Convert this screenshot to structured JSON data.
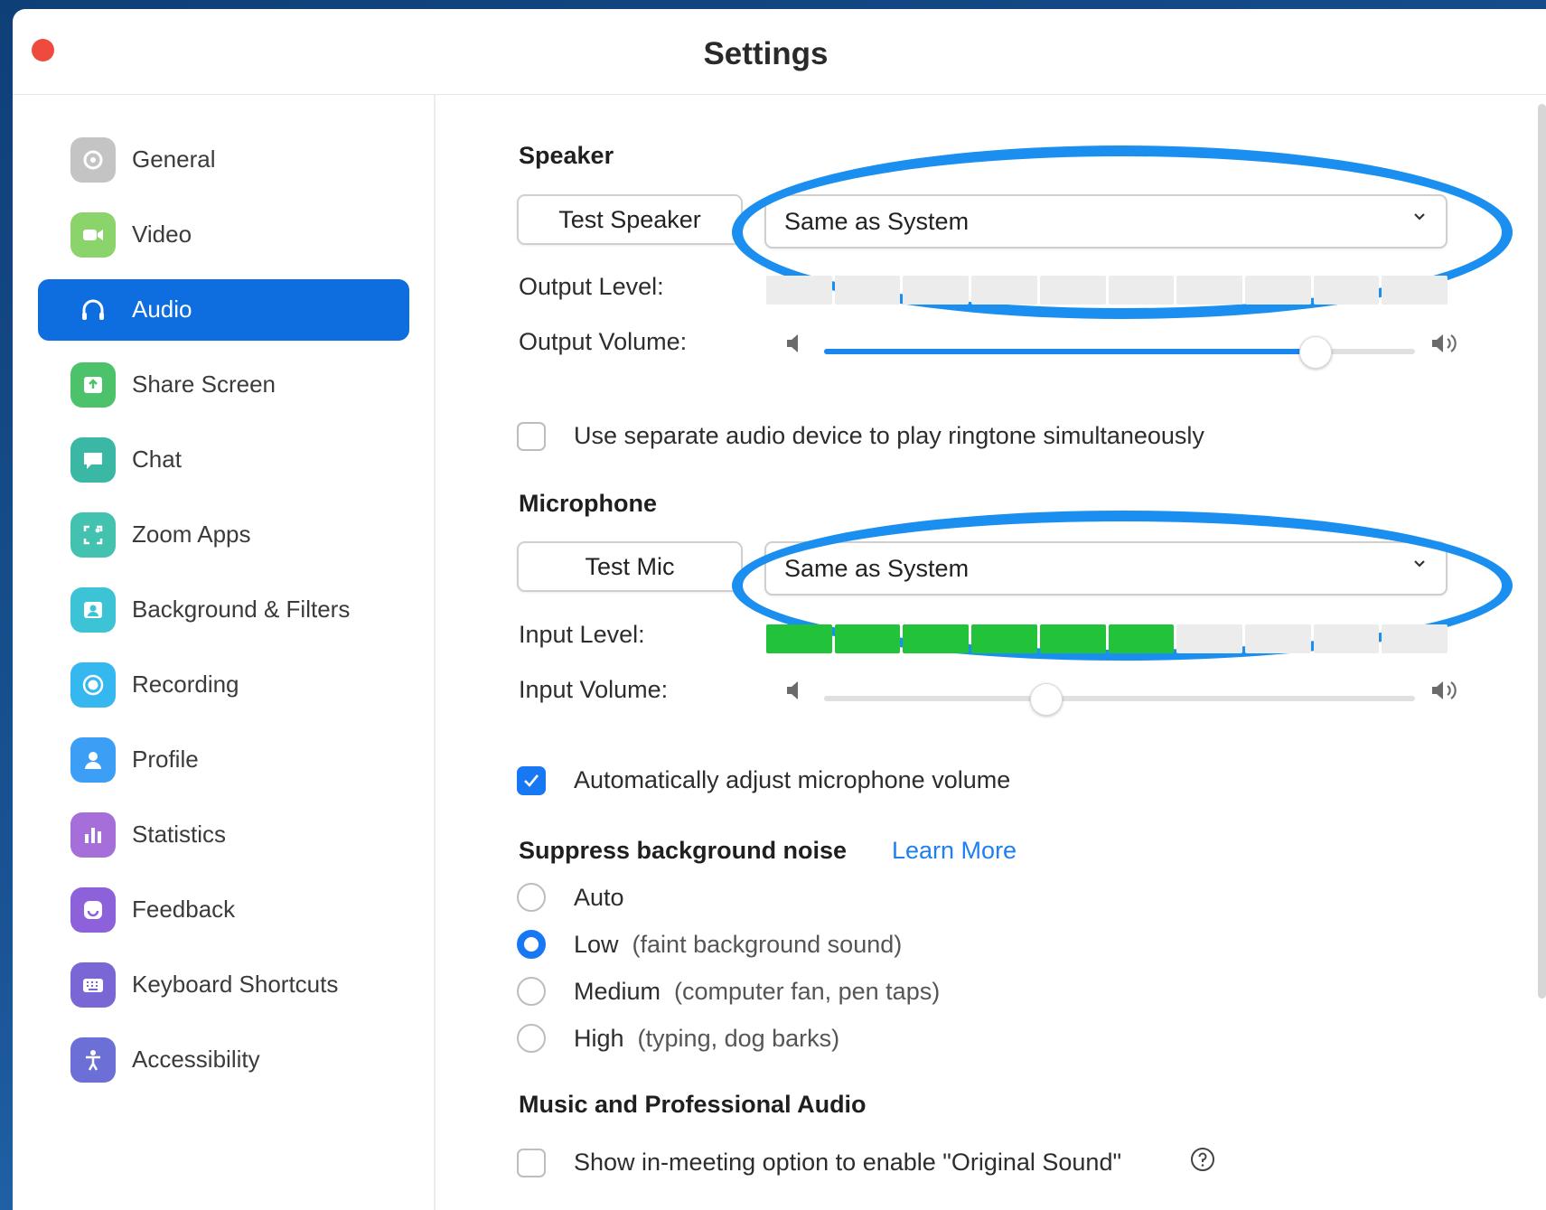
{
  "window": {
    "title": "Settings"
  },
  "sidebar": {
    "items": [
      {
        "label": "General",
        "color": "#b9b9b9"
      },
      {
        "label": "Video",
        "color": "#8bd36b"
      },
      {
        "label": "Audio",
        "color": "#0e6ee0"
      },
      {
        "label": "Share Screen",
        "color": "#4cc26b"
      },
      {
        "label": "Chat",
        "color": "#3bb7a5"
      },
      {
        "label": "Zoom Apps",
        "color": "#43c2b0"
      },
      {
        "label": "Background & Filters",
        "color": "#3cc3d6"
      },
      {
        "label": "Recording",
        "color": "#35b8f0"
      },
      {
        "label": "Profile",
        "color": "#3d9ef5"
      },
      {
        "label": "Statistics",
        "color": "#a56ed8"
      },
      {
        "label": "Feedback",
        "color": "#8d61d9"
      },
      {
        "label": "Keyboard Shortcuts",
        "color": "#7b66d6"
      },
      {
        "label": "Accessibility",
        "color": "#6b6fd6"
      }
    ],
    "active_index": 2
  },
  "speaker": {
    "heading": "Speaker",
    "test_button": "Test Speaker",
    "device": "Same as System",
    "output_level_label": "Output Level:",
    "output_level_segments_on": 0,
    "output_level_segments_total": 10,
    "output_volume_label": "Output Volume:",
    "output_volume": 0.83,
    "separate_device_label": "Use separate audio device to play ringtone simultaneously",
    "separate_device_checked": false
  },
  "microphone": {
    "heading": "Microphone",
    "test_button": "Test Mic",
    "device": "Same as System",
    "input_level_label": "Input Level:",
    "input_level_segments_on": 6,
    "input_level_segments_total": 10,
    "input_volume_label": "Input Volume:",
    "input_volume": 0.375,
    "auto_adjust_label": "Automatically adjust microphone volume",
    "auto_adjust_checked": true
  },
  "noise": {
    "heading": "Suppress background noise",
    "learn_more": "Learn More",
    "options": [
      {
        "label": "Auto",
        "hint": ""
      },
      {
        "label": "Low",
        "hint": "(faint background sound)"
      },
      {
        "label": "Medium",
        "hint": "(computer fan, pen taps)"
      },
      {
        "label": "High",
        "hint": "(typing, dog barks)"
      }
    ],
    "selected_index": 1
  },
  "music": {
    "heading": "Music and Professional Audio",
    "original_sound_label": "Show in-meeting option to enable \"Original Sound\"",
    "original_sound_checked": false
  },
  "colors": {
    "accent": "#0e6ee0",
    "highlight_ring": "#1a8ff0",
    "level_on": "#22c33a"
  }
}
